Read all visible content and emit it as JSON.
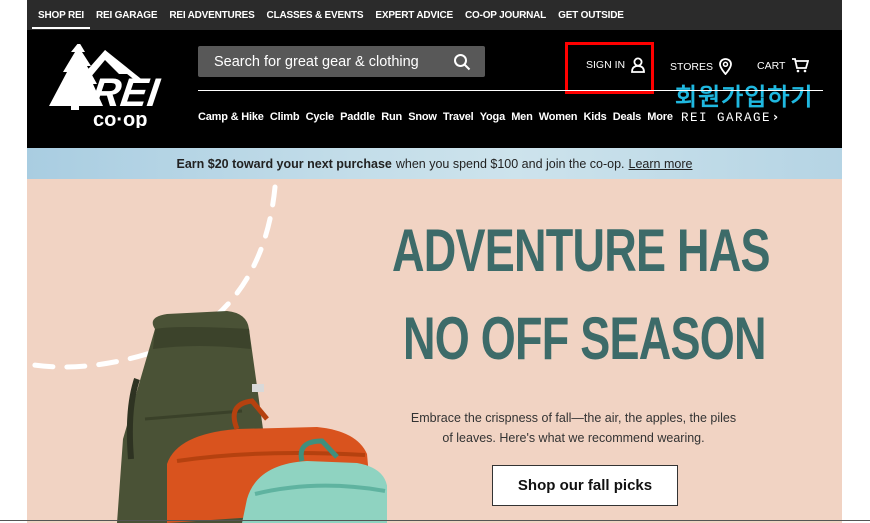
{
  "util_nav": {
    "items": [
      "SHOP REI",
      "REI GARAGE",
      "REI ADVENTURES",
      "CLASSES & EVENTS",
      "EXPERT ADVICE",
      "CO-OP JOURNAL",
      "GET OUTSIDE"
    ]
  },
  "header": {
    "logo_text": "REI co-op",
    "search_placeholder": "Search for great gear & clothing",
    "signin_label": "SIGN IN",
    "stores_label": "STORES",
    "cart_label": "CART",
    "annotation_korean": "회원가입하기",
    "annotation_color": "#1fb8e0",
    "highlight_color": "#ff0000"
  },
  "category_nav": {
    "items": [
      "Camp & Hike",
      "Climb",
      "Cycle",
      "Paddle",
      "Run",
      "Snow",
      "Travel",
      "Yoga",
      "Men",
      "Women",
      "Kids",
      "Deals",
      "More"
    ],
    "garage_label": "REI GARAGE"
  },
  "promo": {
    "bold_text": "Earn $20 toward your next purchase",
    "rest_text": "when you spend $100 and join the co-op.",
    "link_text": "Learn more"
  },
  "hero": {
    "headline_line1": "ADVENTURE HAS",
    "headline_line2": "NO OFF SEASON",
    "body_line1": "Embrace the crispness of fall—the air, the apples, the piles",
    "body_line2": "of leaves. Here's what we recommend wearing.",
    "cta_label": "Shop our fall picks",
    "headline_color": "#3d6b69",
    "background_color": "#f1d3c3"
  }
}
